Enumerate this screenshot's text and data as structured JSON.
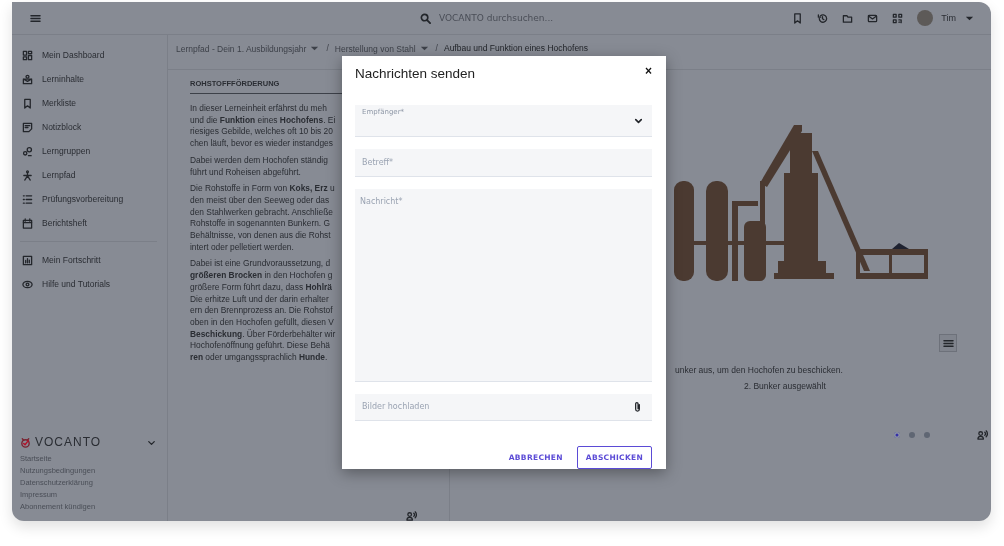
{
  "topbar": {
    "search_placeholder": "VOCANTO durchsuchen...",
    "user": "Tim"
  },
  "sidebar": {
    "groups": [
      {
        "items": [
          {
            "label": "Mein Dashboard"
          },
          {
            "label": "Lerninhalte"
          },
          {
            "label": "Merkliste"
          },
          {
            "label": "Notizblock"
          },
          {
            "label": "Lerngruppen"
          },
          {
            "label": "Lernpfad"
          },
          {
            "label": "Prüfungsvorbereitung"
          },
          {
            "label": "Berichtsheft"
          }
        ]
      },
      {
        "items": [
          {
            "label": "Mein Fortschritt"
          },
          {
            "label": "Hilfe und Tutorials"
          }
        ]
      }
    ],
    "brand": "VOCANTO",
    "footer_links": [
      "Startseite",
      "Nutzungsbedingungen",
      "Datenschutzerklärung",
      "Impressum",
      "Abonnement kündigen"
    ]
  },
  "breadcrumb": [
    {
      "label": "Lernpfad - Dein 1. Ausbildungsjahr",
      "dropdown": true,
      "selected": false
    },
    {
      "separator": "/",
      "label": "Herstellung von Stahl",
      "dropdown": true,
      "selected": false
    },
    {
      "separator": "/",
      "label": "Aufbau und Funktion eines Hochofens",
      "dropdown": false,
      "selected": true
    }
  ],
  "article": {
    "heading": "ROHSTOFFFÖRDERUNG",
    "paragraphs": [
      [
        "In dieser Lerneinheit erfährst du meh",
        "und die **Funktion** eines **Hochofens**. Ei",
        "riesiges Gebilde, welches oft 10 bis 20",
        "chen läuft, bevor es wieder instandges"
      ],
      [
        "Dabei werden dem Hochofen ständig",
        "führt und Roheisen abgeführt."
      ],
      [
        "Die Rohstoffe in Form von **Koks, Erz** u",
        "den meist über den Seeweg oder das",
        "den Stahlwerken gebracht. Anschließe",
        "Rohstoffe in sogenannten Bunkern. G",
        "Behältnisse, von denen aus die Rohst",
        "intert oder pelletiert werden."
      ],
      [
        "Dabei ist eine Grundvoraussetzung, d",
        "**größeren Brocken** in den Hochofen g",
        "größere Form führt dazu, dass **Hohlrä**",
        "Die erhitze Luft und der darin erhalter",
        "ern den Brennprozess an. Die Rohstof",
        "oben in den Hochofen gefüllt, diesen V",
        "**Beschickung**. Über Förderbehälter wir",
        "Hochofenöffnung geführt. Diese Behä",
        "**ren** oder umgangssprachlich **Hunde**."
      ]
    ]
  },
  "viewer": {
    "instruction": "unker aus, um den Hochofen zu beschicken.",
    "status": "2. Bunker ausgewählt",
    "dots": [
      {
        "selected": true
      },
      {
        "selected": false
      },
      {
        "selected": false
      }
    ]
  },
  "dialog": {
    "title": "Nachrichten senden",
    "close": "×",
    "fields": [
      {
        "kind": "select",
        "label": "Empfänger*"
      },
      {
        "kind": "input",
        "placeholder": "Betreff*"
      },
      {
        "kind": "textarea",
        "placeholder": "Nachricht*"
      },
      {
        "kind": "upload",
        "placeholder": "Bilder hochladen"
      }
    ],
    "buttons": [
      {
        "label": "ABBRECHEN",
        "kind": "text"
      },
      {
        "label": "ABSCHICKEN",
        "kind": "outlined"
      }
    ]
  }
}
